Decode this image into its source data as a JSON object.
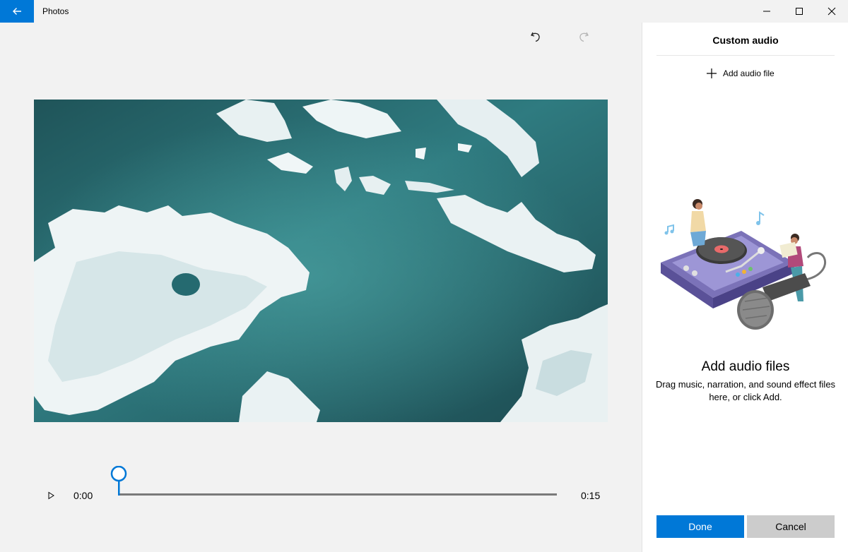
{
  "window": {
    "app_title": "Photos",
    "back_icon": "arrow-left-icon",
    "minimize_icon": "minimize-icon",
    "maximize_icon": "maximize-icon",
    "close_icon": "close-icon",
    "accent_color": "#0078d7"
  },
  "toolbar": {
    "undo_icon": "undo-icon",
    "redo_icon": "redo-icon"
  },
  "player": {
    "play_icon": "play-icon",
    "current_time": "0:00",
    "duration": "0:15",
    "progress": 0.0
  },
  "panel": {
    "title": "Custom audio",
    "add_file_label": "Add audio file",
    "add_icon": "plus-icon",
    "empty_heading": "Add audio files",
    "empty_description": "Drag music, narration, and sound effect files here, or click Add.",
    "done_label": "Done",
    "cancel_label": "Cancel"
  }
}
